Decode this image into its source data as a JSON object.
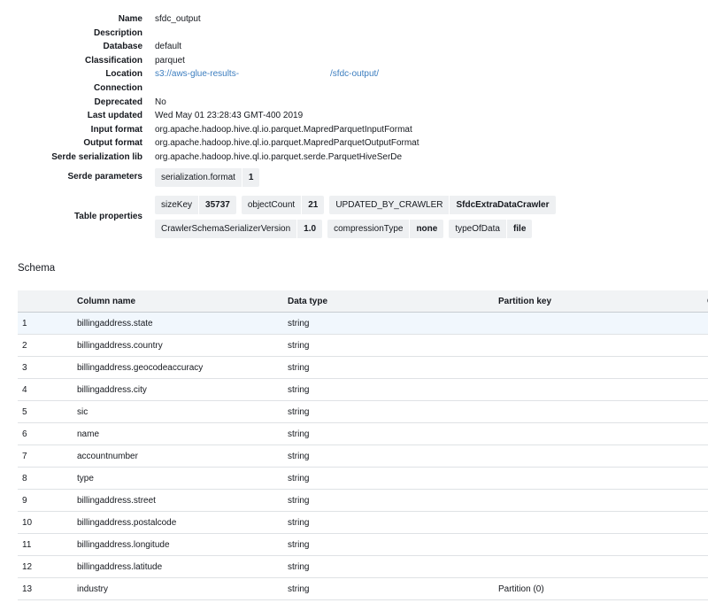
{
  "table_details": {
    "name": {
      "label": "Name",
      "value": "sfdc_output"
    },
    "description": {
      "label": "Description",
      "value": ""
    },
    "database": {
      "label": "Database",
      "value": "default"
    },
    "classification": {
      "label": "Classification",
      "value": "parquet"
    },
    "location": {
      "label": "Location",
      "value_prefix": "s3://aws-glue-results-",
      "value_suffix": "/sfdc-output/"
    },
    "connection": {
      "label": "Connection",
      "value": ""
    },
    "deprecated": {
      "label": "Deprecated",
      "value": "No"
    },
    "last_updated": {
      "label": "Last updated",
      "value": "Wed May 01 23:28:43 GMT-400 2019"
    },
    "input_format": {
      "label": "Input format",
      "value": "org.apache.hadoop.hive.ql.io.parquet.MapredParquetInputFormat"
    },
    "output_format": {
      "label": "Output format",
      "value": "org.apache.hadoop.hive.ql.io.parquet.MapredParquetOutputFormat"
    },
    "serde_lib": {
      "label": "Serde serialization lib",
      "value": "org.apache.hadoop.hive.ql.io.parquet.serde.ParquetHiveSerDe"
    },
    "serde_params": {
      "label": "Serde parameters",
      "items": [
        {
          "key": "serialization.format",
          "value": "1"
        }
      ]
    },
    "table_properties": {
      "label": "Table properties",
      "items": [
        {
          "key": "sizeKey",
          "value": "35737"
        },
        {
          "key": "objectCount",
          "value": "21"
        },
        {
          "key": "UPDATED_BY_CRAWLER",
          "value": "SfdcExtraDataCrawler"
        },
        {
          "key": "CrawlerSchemaSerializerVersion",
          "value": "1.0"
        },
        {
          "key": "compressionType",
          "value": "none"
        },
        {
          "key": "typeOfData",
          "value": "file"
        }
      ]
    }
  },
  "schema": {
    "title": "Schema",
    "headers": {
      "number": "",
      "column_name": "Column name",
      "data_type": "Data type",
      "partition_key": "Partition key",
      "more": "C"
    },
    "rows": [
      {
        "num": "1",
        "name": "billingaddress.state",
        "type": "string",
        "partition": ""
      },
      {
        "num": "2",
        "name": "billingaddress.country",
        "type": "string",
        "partition": ""
      },
      {
        "num": "3",
        "name": "billingaddress.geocodeaccuracy",
        "type": "string",
        "partition": ""
      },
      {
        "num": "4",
        "name": "billingaddress.city",
        "type": "string",
        "partition": ""
      },
      {
        "num": "5",
        "name": "sic",
        "type": "string",
        "partition": ""
      },
      {
        "num": "6",
        "name": "name",
        "type": "string",
        "partition": ""
      },
      {
        "num": "7",
        "name": "accountnumber",
        "type": "string",
        "partition": ""
      },
      {
        "num": "8",
        "name": "type",
        "type": "string",
        "partition": ""
      },
      {
        "num": "9",
        "name": "billingaddress.street",
        "type": "string",
        "partition": ""
      },
      {
        "num": "10",
        "name": "billingaddress.postalcode",
        "type": "string",
        "partition": ""
      },
      {
        "num": "11",
        "name": "billingaddress.longitude",
        "type": "string",
        "partition": ""
      },
      {
        "num": "12",
        "name": "billingaddress.latitude",
        "type": "string",
        "partition": ""
      },
      {
        "num": "13",
        "name": "industry",
        "type": "string",
        "partition": "Partition (0)"
      }
    ]
  },
  "colors": {
    "link": "#3b7dbf",
    "header_bg": "#f1f3f5",
    "selected_row_bg": "#f1f7fd",
    "tag_bg": "#eef0f2"
  }
}
